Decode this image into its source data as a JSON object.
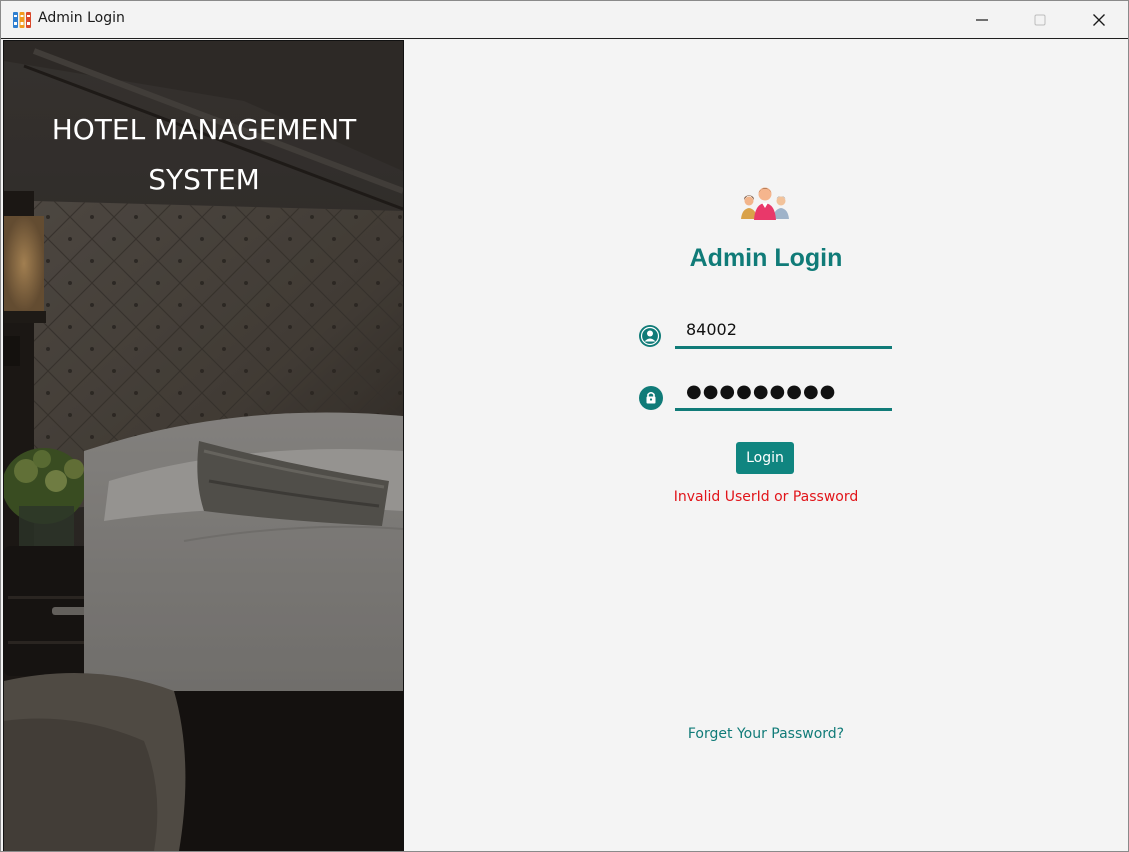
{
  "window": {
    "title": "Admin Login"
  },
  "banner": {
    "title_line1": "HOTEL MANAGEMENT",
    "title_line2": "SYSTEM"
  },
  "form": {
    "heading": "Admin Login",
    "userid_value": "84002",
    "password_value": "●●●●●●●●●",
    "login_label": "Login",
    "error_message": "Invalid UserId or Password",
    "forgot_link": "Forget Your Password?"
  },
  "icons": {
    "app": "app-icon",
    "minimize": "minimize-icon",
    "maximize": "maximize-icon",
    "close": "close-icon",
    "users": "users-icon",
    "user": "user-icon",
    "lock": "lock-icon"
  },
  "colors": {
    "accent": "#107b78",
    "button": "#108580",
    "error": "#e1151a",
    "panel_background": "#f4f4f4"
  }
}
